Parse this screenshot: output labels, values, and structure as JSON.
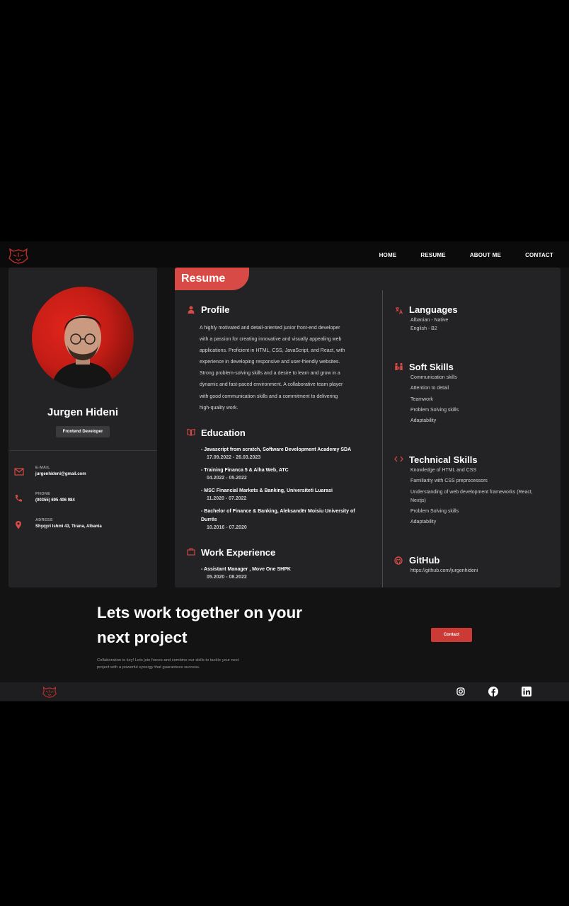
{
  "nav": {
    "items": [
      "HOME",
      "RESUME",
      "ABOUT ME",
      "CONTACT"
    ]
  },
  "sidebar": {
    "name": "Jurgen Hideni",
    "role": "Frontend Developer",
    "contacts": [
      {
        "label": "E-MAIL",
        "value": "jurgenhideni@gmail.com",
        "icon": "mail-icon"
      },
      {
        "label": "PHONE",
        "value": "(00355) 695 406 984",
        "icon": "phone-icon"
      },
      {
        "label": "ADRESS",
        "value": "Shyqyri Ishmi 43, Tirana, Albania",
        "icon": "location-icon"
      }
    ]
  },
  "resume": {
    "tab_label": "Resume",
    "profile": {
      "title": "Profile",
      "lines": [
        "A highly motivated and detail-oriented junior front-end developer",
        "with a passion for creating innovative and visually appealing web",
        "applications. Proficient in HTML, CSS, JavaScript, and React, with",
        "experience in developing responsive and user-friendly websites.",
        "Strong problem-solving skills and a desire to learn and grow in a",
        "dynamic and fast-paced environment. A collaborative team player",
        "with good communication skills and a commitment to delivering",
        "high-quality work."
      ]
    },
    "education": {
      "title": "Education",
      "items": [
        {
          "line1": "- Javascript from scratch, Software Development Academy SDA",
          "line2": "",
          "date": "17.09.2022 - 26.03.2023"
        },
        {
          "line1": "- Training Financa 5 & Alha Web, ATC",
          "line2": "",
          "date": "04.2022 - 05.2022"
        },
        {
          "line1": "- MSC Financial Markets & Banking, Universiteti Luarasi",
          "line2": "",
          "date": "11.2020 - 07.2022"
        },
        {
          "line1": "- Bachelor of Finance & Banking, Aleksandër Moisiu University of",
          "line2": "Durrës",
          "date": "10.2016 - 07.2020"
        }
      ]
    },
    "work": {
      "title": "Work Experience",
      "items": [
        {
          "line1": "- Assistant Manager , Move One SHPK",
          "date": "05.2020 - 08.2022"
        }
      ]
    },
    "languages": {
      "title": "Languages",
      "items": [
        "Albanian - Native",
        "English - B2"
      ]
    },
    "soft_skills": {
      "title": "Soft Skills",
      "items": [
        "Communication skills",
        "Attention to detail",
        "Teamwork",
        "Problem Solving skills",
        "Adaptability"
      ]
    },
    "technical_skills": {
      "title": "Technical Skills",
      "items": [
        "Knowledge of HTML and CSS",
        "Familiarity with CSS preprocessors",
        "Understanding of web development frameworks (React,",
        "Nextjs)",
        "Problem Solving skills",
        "Adaptability"
      ]
    },
    "github": {
      "title": "GitHub",
      "url": "https://github.com/jurgenhideni"
    }
  },
  "cta": {
    "title_line1": "Lets work together on your",
    "title_line2": "next project",
    "text_line1": "Collaboration is key! Lets join forces and combine our skills to tackle your next",
    "text_line2": "project with a powerful synergy that guarantees success.",
    "button": "Contact"
  },
  "footer": {
    "socials": [
      "instagram-icon",
      "facebook-icon",
      "linkedin-icon"
    ]
  },
  "colors": {
    "accent": "#d84a45",
    "card": "#232325",
    "background": "#131313"
  }
}
